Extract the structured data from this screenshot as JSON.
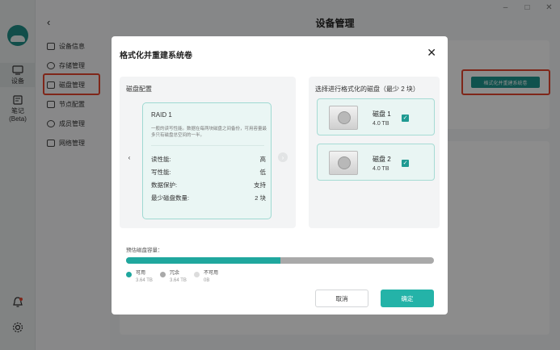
{
  "window": {
    "minimize": "–",
    "maximize": "□",
    "close": "✕"
  },
  "rail": {
    "devices_label": "设备",
    "notes_label": "笔记",
    "notes_sub": "(Beta)"
  },
  "sidenav": {
    "items": [
      {
        "label": "设备信息"
      },
      {
        "label": "存储管理"
      },
      {
        "label": "磁盘管理"
      },
      {
        "label": "节点配置"
      },
      {
        "label": "成员管理"
      },
      {
        "label": "网络管理"
      }
    ]
  },
  "page": {
    "title": "设备管理",
    "format_button": "格式化并重建系统卷"
  },
  "dialog": {
    "title": "格式化并重建系统卷",
    "close": "✕",
    "raid_config_title": "磁盘配置",
    "raid": {
      "name": "RAID 1",
      "description": "一般的读写性能。数据在每两块磁盘之间备份，可用容量最多只有磁盘总空间的一半。",
      "rows": [
        {
          "label": "读性能:",
          "value": "高"
        },
        {
          "label": "写性能:",
          "value": "低"
        },
        {
          "label": "数据保护:",
          "value": "支持"
        },
        {
          "label": "最少磁盘数量:",
          "value": "2 块"
        }
      ]
    },
    "disk_select_title": "选择进行格式化的磁盘（最少 2 块）",
    "disks": [
      {
        "name": "磁盘 1",
        "size": "4.0 TB",
        "checked": true
      },
      {
        "name": "磁盘 2",
        "size": "4.0 TB",
        "checked": true
      }
    ],
    "capacity": {
      "label": "预估磁盘容量：",
      "usable_fraction": 0.5,
      "legend": [
        {
          "name": "可用",
          "value": "3.64 TB",
          "color": "#1fa79e"
        },
        {
          "name": "冗余",
          "value": "3.64 TB",
          "color": "#a9a9a9"
        },
        {
          "name": "不可用",
          "value": "0B",
          "color": "#dcdcdc"
        }
      ]
    },
    "cancel_label": "取消",
    "confirm_label": "确定"
  },
  "colors": {
    "accent": "#1fa79e",
    "highlight": "#e8452e"
  }
}
